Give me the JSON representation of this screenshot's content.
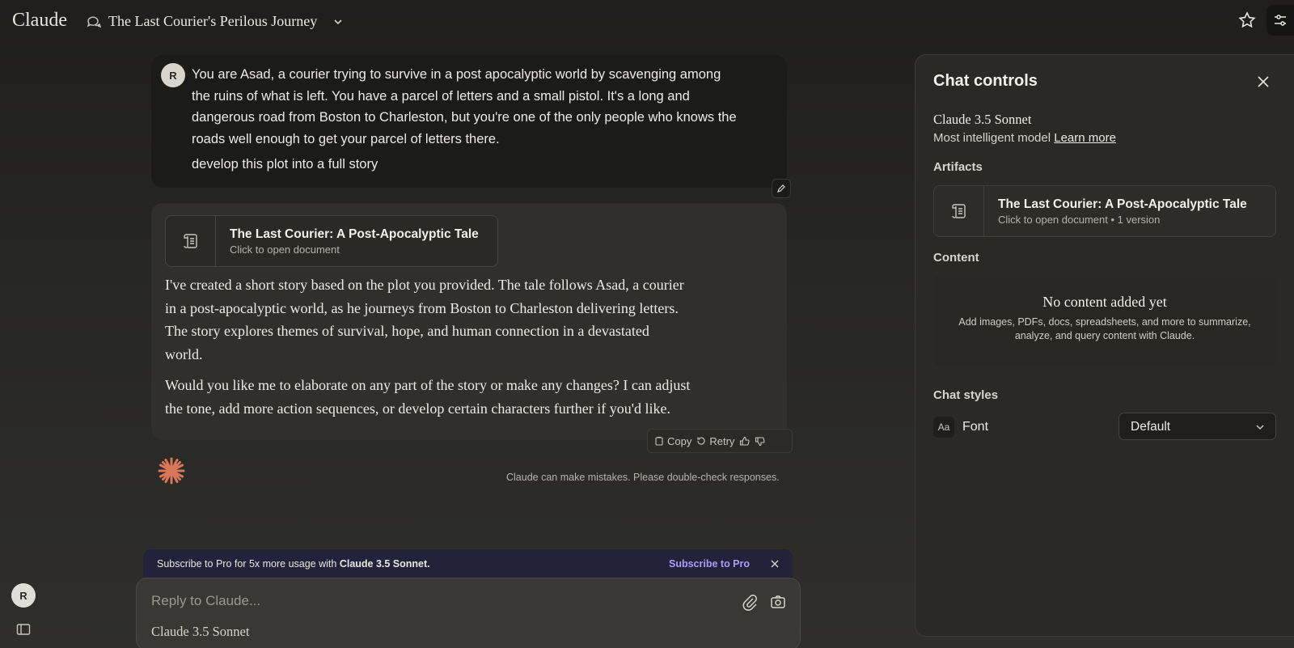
{
  "header": {
    "logo": "Claude",
    "chat_title": "The Last Courier's Perilous Journey"
  },
  "user_message": {
    "avatar_initial": "R",
    "prompt_lines": [
      "You are  Asad, a courier trying to survive in a post apocalyptic world by scavenging among",
      "the ruins of what is left. You have a parcel of letters and a small pistol. It's a long and",
      "dangerous road from Boston to Charleston, but you're one of the only people who knows the",
      "roads well enough to get your parcel of letters there."
    ],
    "instruction": "develop this plot into a full story"
  },
  "assistant_message": {
    "artifact": {
      "title": "The Last Courier: A Post-Apocalyptic Tale",
      "subtitle": "Click to open document"
    },
    "paragraph1_lines": [
      "I've created a short story based on the plot you provided. The tale follows Asad, a courier",
      "in a post-apocalyptic world, as he journeys from Boston to Charleston delivering letters.",
      "The story explores themes of survival, hope, and human connection in a devastated",
      "world."
    ],
    "paragraph2_lines": [
      "Would you like me to elaborate on any part of the story or make any changes? I can adjust",
      "the tone, add more action sequences, or develop certain characters further if you'd like."
    ],
    "actions": {
      "copy": "Copy",
      "retry": "Retry"
    }
  },
  "disclaimer": "Claude can make mistakes. Please double-check responses.",
  "pro_banner": {
    "text_prefix": "Subscribe to Pro for 5x more usage with ",
    "text_model": "Claude 3.5 Sonnet.",
    "link": "Subscribe to Pro"
  },
  "composer": {
    "placeholder": "Reply to Claude...",
    "model": "Claude 3.5 Sonnet"
  },
  "sidebar": {
    "avatar_initial": "R"
  },
  "chat_controls": {
    "title": "Chat controls",
    "model_name": "Claude 3.5 Sonnet",
    "model_desc": "Most intelligent model",
    "learn_more": "Learn more",
    "artifacts_heading": "Artifacts",
    "artifact_title": "The Last Courier: A Post-Apocalyptic Tale",
    "artifact_sub": "Click to open document • 1 version",
    "content_heading": "Content",
    "content_empty_title": "No content added yet",
    "content_empty_desc_lines": [
      "Add images, PDFs, docs, spreadsheets, and more to summarize,",
      "analyze, and query content with Claude."
    ],
    "styles_heading": "Chat styles",
    "font_icon": "Aa",
    "font_label": "Font",
    "font_value": "Default"
  },
  "colors": {
    "accent_orange": "#d97757",
    "pro_link": "#a99df5"
  }
}
